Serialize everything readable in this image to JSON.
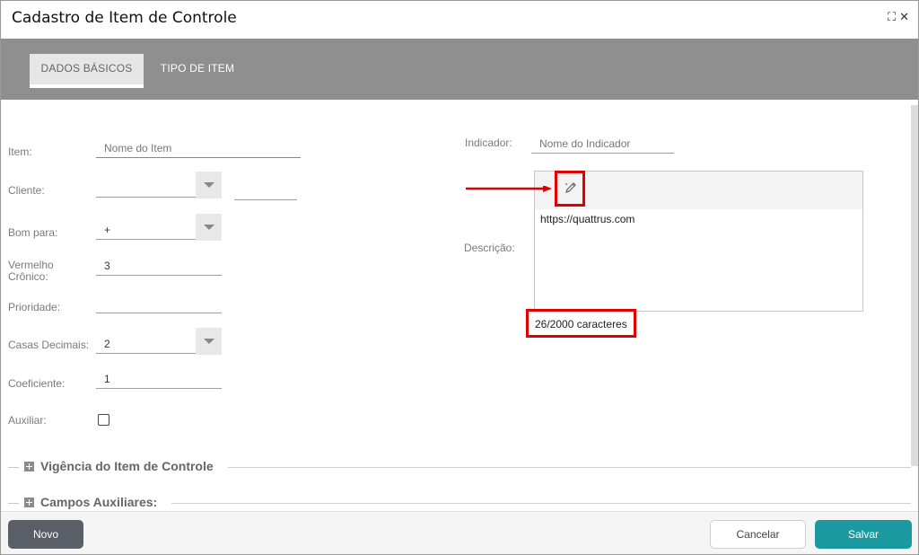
{
  "window": {
    "title": "Cadastro de Item de Controle",
    "expand_glyph": "⛶",
    "close_glyph": "✕"
  },
  "tabs": [
    {
      "label": "DADOS BÁSICOS",
      "active": true
    },
    {
      "label": "TIPO DE ITEM",
      "active": false
    }
  ],
  "form": {
    "item": {
      "label": "Item:",
      "placeholder": "Nome do Item"
    },
    "cliente": {
      "label": "Cliente:",
      "value": ""
    },
    "bom_para": {
      "label": "Bom para:",
      "value": "+"
    },
    "vermelho_cronico": {
      "label_line1": "Vermelho",
      "label_line2": "Crônico:",
      "value": "3"
    },
    "prioridade": {
      "label": "Prioridade:",
      "value": ""
    },
    "casas_decimais": {
      "label": "Casas Decimais:",
      "value": "2"
    },
    "coeficiente": {
      "label": "Coeficiente:",
      "value": "1"
    },
    "auxiliar": {
      "label": "Auxiliar:",
      "checked": false
    },
    "indicador": {
      "label": "Indicador:",
      "placeholder": "Nome do Indicador"
    },
    "descricao": {
      "label": "Descrição:",
      "text": "https://quattrus.com",
      "char_count": "26/2000 caracteres"
    }
  },
  "sections": [
    {
      "title": "Vigência do Item de Controle"
    },
    {
      "title": "Campos Auxiliares:"
    }
  ],
  "footer": {
    "novo": "Novo",
    "cancelar": "Cancelar",
    "salvar": "Salvar"
  },
  "colors": {
    "annotation_red": "#e00000",
    "save_teal": "#1a9aa0",
    "tabbar_gray": "#8f8f8f"
  }
}
